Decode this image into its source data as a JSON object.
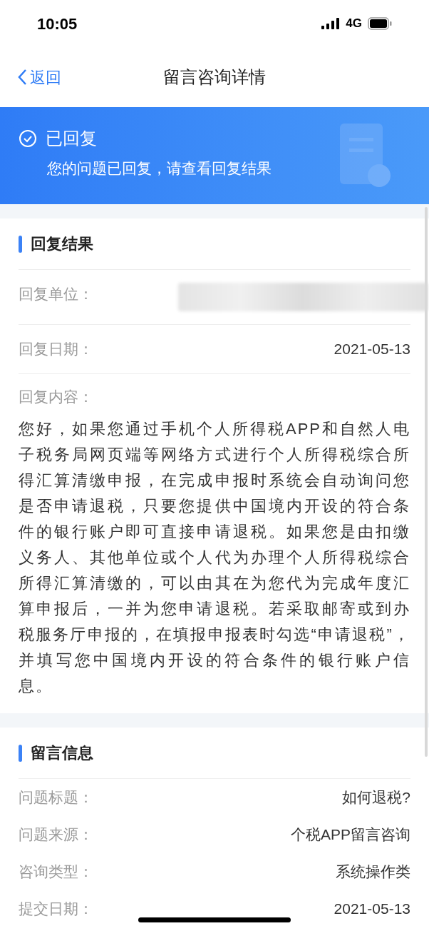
{
  "status_bar": {
    "time": "10:05",
    "network": "4G"
  },
  "nav": {
    "back": "返回",
    "title": "留言咨询详情"
  },
  "banner": {
    "status": "已回复",
    "message": "您的问题已回复，请查看回复结果"
  },
  "reply": {
    "heading": "回复结果",
    "fields": [
      {
        "kind": "redacted",
        "label": "回复单位："
      },
      {
        "kind": "value",
        "label": "回复日期：",
        "value": "2021-05-13"
      }
    ],
    "content_label": "回复内容：",
    "content": "您好，如果您通过手机个人所得税APP和自然人电子税务局网页端等网络方式进行个人所得税综合所得汇算清缴申报，在完成申报时系统会自动询问您是否申请退税，只要您提供中国境内开设的符合条件的银行账户即可直接申请退税。如果您是由扣缴义务人、其他单位或个人代为办理个人所得税综合所得汇算清缴的，可以由其在为您代为完成年度汇算申报后，一并为您申请退税。若采取邮寄或到办税服务厅申报的，在填报申报表时勾选“申请退税”，并填写您中国境内开设的符合条件的银行账户信息。"
  },
  "message": {
    "heading": "留言信息",
    "fields": [
      {
        "kind": "value",
        "label": "问题标题：",
        "value": "如何退税?"
      },
      {
        "kind": "value",
        "label": "问题来源：",
        "value": "个税APP留言咨询"
      },
      {
        "kind": "value",
        "label": "咨询类型：",
        "value": "系统操作类"
      },
      {
        "kind": "value",
        "label": "提交日期：",
        "value": "2021-05-13"
      }
    ]
  }
}
